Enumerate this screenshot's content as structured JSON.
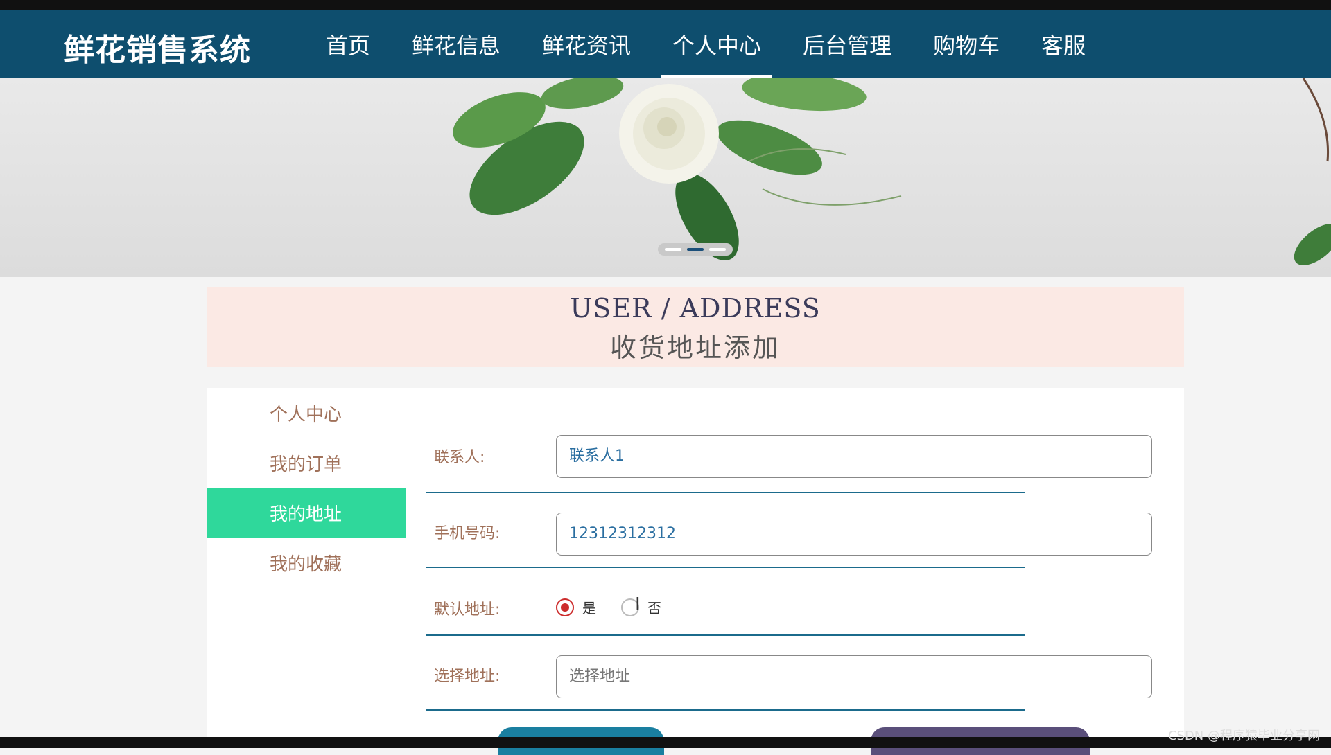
{
  "brand": "鲜花销售系统",
  "nav": [
    {
      "label": "首页"
    },
    {
      "label": "鲜花信息"
    },
    {
      "label": "鲜花资讯"
    },
    {
      "label": "个人中心",
      "active": true
    },
    {
      "label": "后台管理"
    },
    {
      "label": "购物车"
    },
    {
      "label": "客服"
    }
  ],
  "heading": {
    "en": "USER / ADDRESS",
    "cn": "收货地址添加"
  },
  "sidebar": [
    {
      "label": "个人中心"
    },
    {
      "label": "我的订单"
    },
    {
      "label": "我的地址",
      "active": true
    },
    {
      "label": "我的收藏"
    }
  ],
  "form": {
    "contact": {
      "label": "联系人:",
      "value": "联系人1"
    },
    "phone": {
      "label": "手机号码:",
      "value": "12312312312"
    },
    "default": {
      "label": "默认地址:",
      "yes": "是",
      "no": "否",
      "selected": "yes"
    },
    "address": {
      "label": "选择地址:",
      "placeholder": "选择地址"
    }
  },
  "watermark": "CSDN @程序猿毕业分享网",
  "colors": {
    "nav_bg": "#0e4e6e",
    "active_side": "#2fd89b",
    "heading_bg": "#fbe9e4"
  }
}
